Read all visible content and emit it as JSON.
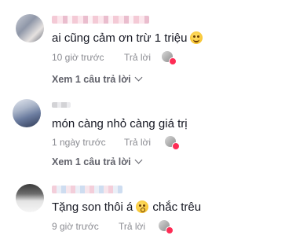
{
  "comments": [
    {
      "text": "ai cũng cảm ơn trừ 1 triệu",
      "emoji": "grinning-sweat-emoji",
      "time": "10 giờ trước",
      "reply": "Trả lời",
      "view_replies": "Xem 1 câu trả lời"
    },
    {
      "text": "món càng nhỏ càng giá trị",
      "time": "1 ngày trước",
      "reply": "Trả lời",
      "view_replies": "Xem 1 câu trả lời"
    },
    {
      "text_before": "Tặng son thôi á",
      "emoji": "hushed-face-emoji",
      "text_after": "chắc trêu",
      "time": "9 giờ trước",
      "reply": "Trả lời"
    }
  ],
  "colors": {
    "text": "#161823",
    "meta": "#8a8b91",
    "like_dot": "#fe2c55"
  }
}
